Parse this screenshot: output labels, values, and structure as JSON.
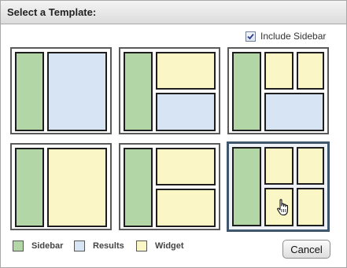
{
  "dialog": {
    "title": "Select a Template:"
  },
  "options": {
    "include_sidebar_label": "Include Sidebar",
    "include_sidebar_checked": true
  },
  "templates": [
    {
      "id": "sidebar-results",
      "zones": [
        "sidebar",
        "results"
      ],
      "selected": false
    },
    {
      "id": "sidebar-widget-results",
      "zones": [
        "sidebar",
        "widget",
        "results"
      ],
      "selected": false
    },
    {
      "id": "sidebar-two-widgets-results",
      "zones": [
        "sidebar",
        "widget",
        "widget",
        "results"
      ],
      "selected": false
    },
    {
      "id": "sidebar-widget",
      "zones": [
        "sidebar",
        "widget"
      ],
      "selected": false
    },
    {
      "id": "sidebar-two-widgets-stacked",
      "zones": [
        "sidebar",
        "widget",
        "widget"
      ],
      "selected": false
    },
    {
      "id": "sidebar-four-widgets",
      "zones": [
        "sidebar",
        "widget",
        "widget",
        "widget",
        "widget"
      ],
      "selected": true
    }
  ],
  "legend": {
    "sidebar_label": "Sidebar",
    "results_label": "Results",
    "widget_label": "Widget"
  },
  "colors": {
    "sidebar": "#b3d6a6",
    "results": "#d6e4f4",
    "widget": "#fbf6c6",
    "selected_border": "#3f566c"
  },
  "actions": {
    "cancel_label": "Cancel"
  },
  "icons": {
    "checkbox": "checkmark-icon",
    "cursor": "hand-pointer-icon"
  }
}
